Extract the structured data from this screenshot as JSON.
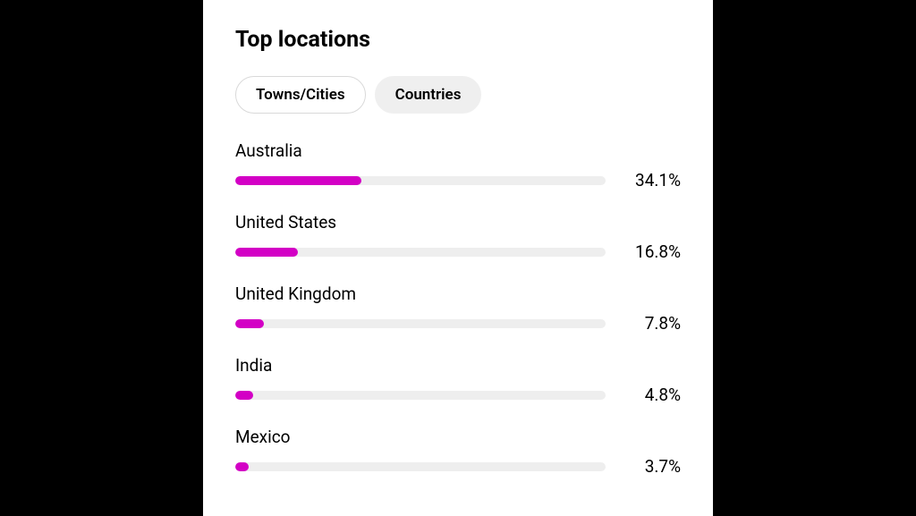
{
  "title": "Top locations",
  "tabs": {
    "towns_label": "Towns/Cities",
    "countries_label": "Countries",
    "active": "towns"
  },
  "chart_data": {
    "type": "bar",
    "title": "Top locations",
    "xlabel": "",
    "ylabel": "",
    "ylim": [
      0,
      100
    ],
    "categories": [
      "Australia",
      "United States",
      "United Kingdom",
      "India",
      "Mexico"
    ],
    "values": [
      34.1,
      16.8,
      7.8,
      4.8,
      3.7
    ],
    "value_labels": [
      "34.1%",
      "16.8%",
      "7.8%",
      "4.8%",
      "3.7%"
    ],
    "bar_color": "#d300c5",
    "track_color": "#eeeeee"
  }
}
